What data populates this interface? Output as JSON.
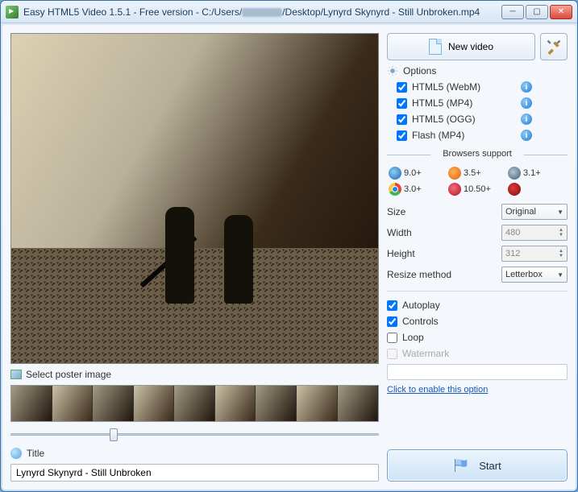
{
  "window": {
    "title_prefix": "Easy HTML5 Video 1.5.1  - Free version - C:/Users/",
    "title_suffix": "/Desktop/Lynyrd Skynyrd - Still Unbroken.mp4"
  },
  "left": {
    "poster_label": "Select poster image",
    "title_label": "Title",
    "title_value": "Lynyrd Skynyrd - Still Unbroken"
  },
  "right": {
    "new_video": "New video",
    "options_label": "Options",
    "formats": [
      {
        "label": "HTML5 (WebM)",
        "checked": true
      },
      {
        "label": "HTML5 (MP4)",
        "checked": true
      },
      {
        "label": "HTML5 (OGG)",
        "checked": true
      },
      {
        "label": "Flash (MP4)",
        "checked": true
      }
    ],
    "browsers_label": "Browsers support",
    "browsers": {
      "ie": "9.0+",
      "ff": "3.5+",
      "sf": "3.1+",
      "ch": "3.0+",
      "op": "10.50+",
      "fl": " "
    },
    "size_label": "Size",
    "size_value": "Original",
    "width_label": "Width",
    "width_value": "480",
    "height_label": "Height",
    "height_value": "312",
    "resize_label": "Resize method",
    "resize_value": "Letterbox",
    "autoplay_label": "Autoplay",
    "autoplay_checked": true,
    "controls_label": "Controls",
    "controls_checked": true,
    "loop_label": "Loop",
    "loop_checked": false,
    "watermark_label": "Watermark",
    "watermark_checked": false,
    "enable_link": "Click to enable this option",
    "start_label": "Start"
  }
}
